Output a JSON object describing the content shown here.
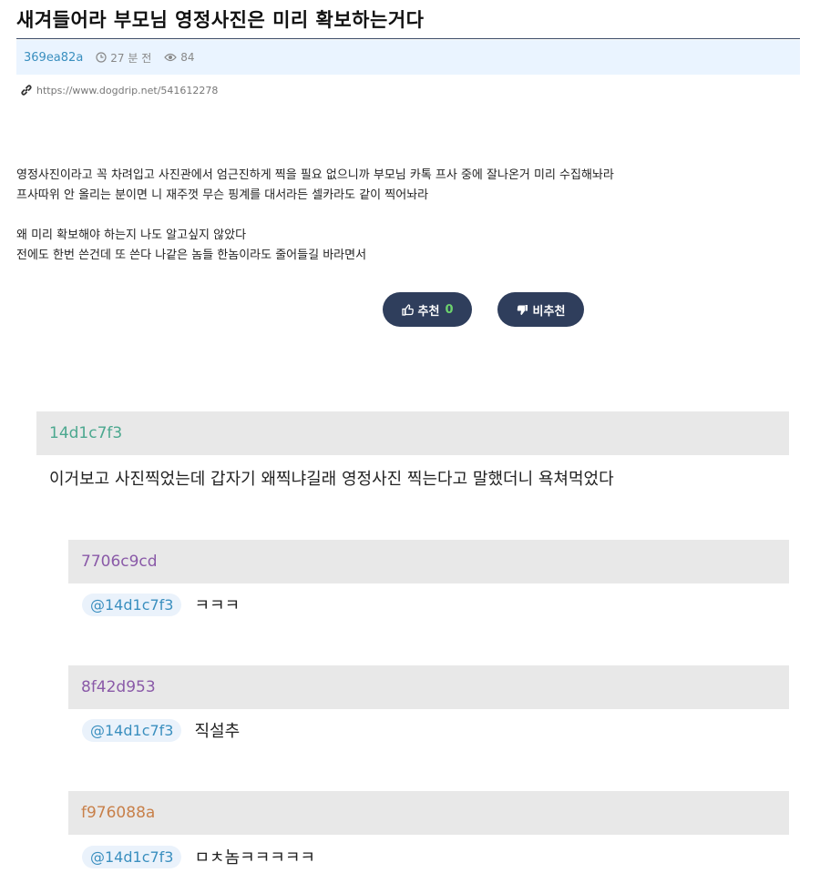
{
  "post": {
    "title": "새겨들어라 부모님 영정사진은 미리 확보하는거다",
    "author": "369ea82a",
    "time": "27 분 전",
    "views": "84",
    "url": "https://www.dogdrip.net/541612278",
    "body": [
      "영정사진이라고 꼭 차려입고 사진관에서 엄근진하게 찍을 필요 없으니까 부모님 카톡 프사 중에 잘나온거 미리 수집해놔라",
      "프사따위 안 올리는 분이면 니 재주껏 무슨 핑계를 대서라든 셀카라도 같이 찍어놔라",
      "",
      "왜 미리 확보해야 하는지 나도 알고싶지 않았다",
      "전에도 한번 쓴건데 또 쓴다 나같은 놈들 한놈이라도 줄어들길 바라면서"
    ]
  },
  "votes": {
    "up_label": "추천",
    "up_count": "0",
    "down_label": "비추천"
  },
  "comments": [
    {
      "author": "14d1c7f3",
      "author_color": "#4ca88f",
      "text": "이거보고 사진찍었는데 갑자기 왜찍냐길래 영정사진 찍는다고 말했더니 욕쳐먹었다"
    },
    {
      "author": "7706c9cd",
      "author_color": "#8a5aa8",
      "mention": "@14d1c7f3",
      "text": "ㅋㅋㅋ"
    },
    {
      "author": "8f42d953",
      "author_color": "#8a5aa8",
      "mention": "@14d1c7f3",
      "text": "직설추"
    },
    {
      "author": "f976088a",
      "author_color": "#c8804a",
      "mention": "@14d1c7f3",
      "text": "ㅁㅊ놈ㅋㅋㅋㅋㅋ"
    }
  ],
  "colors": {
    "accent": "#3a8fbf",
    "vote_button": "#2f3e5c",
    "meta_bar": "#eaf4ff"
  },
  "icons": {
    "time": "clock-icon",
    "views": "eye-icon",
    "link": "link-icon",
    "up": "thumbs-up-icon",
    "down": "thumbs-down-icon"
  }
}
